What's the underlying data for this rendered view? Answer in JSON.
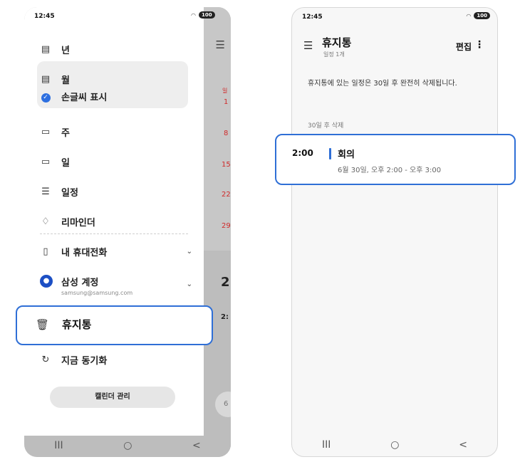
{
  "left_phone": {
    "status_time": "12:45",
    "battery": "100",
    "menu": {
      "year": "년",
      "month": "월",
      "handwriting": "손글씨 표시",
      "week": "주",
      "day": "일",
      "schedule": "일정",
      "reminder": "리마인더",
      "my_phone": "내 휴대전화",
      "samsung_account": "삼성 계정",
      "samsung_email": "samsung@samsung.com",
      "trash": "휴지통",
      "sync_now": "지금 동기화",
      "manage_calendars": "캘린더 관리"
    },
    "calendar_behind": {
      "day_header": "일",
      "dates": [
        "1",
        "8",
        "15",
        "22",
        "29"
      ],
      "big_date": "2",
      "time_fragment": "2:",
      "fab": "6"
    }
  },
  "right_phone": {
    "status_time": "12:45",
    "battery": "100",
    "title": "휴지통",
    "subtitle": "일정 1개",
    "edit_label": "편집",
    "info_text": "휴지통에 있는 일정은 30일 후 완전히 삭제됩니다.",
    "section_label": "30일 후 삭제",
    "event": {
      "time": "2:00",
      "title": "회의",
      "detail": "6월 30일, 오후 2:00 - 오후 3:00",
      "accent": "#2f6fd6"
    }
  },
  "nav": {
    "recents": "III",
    "home": "○",
    "back": "<"
  },
  "colors": {
    "highlight": "#2f6fd6",
    "sunday": "#d02a2a"
  }
}
